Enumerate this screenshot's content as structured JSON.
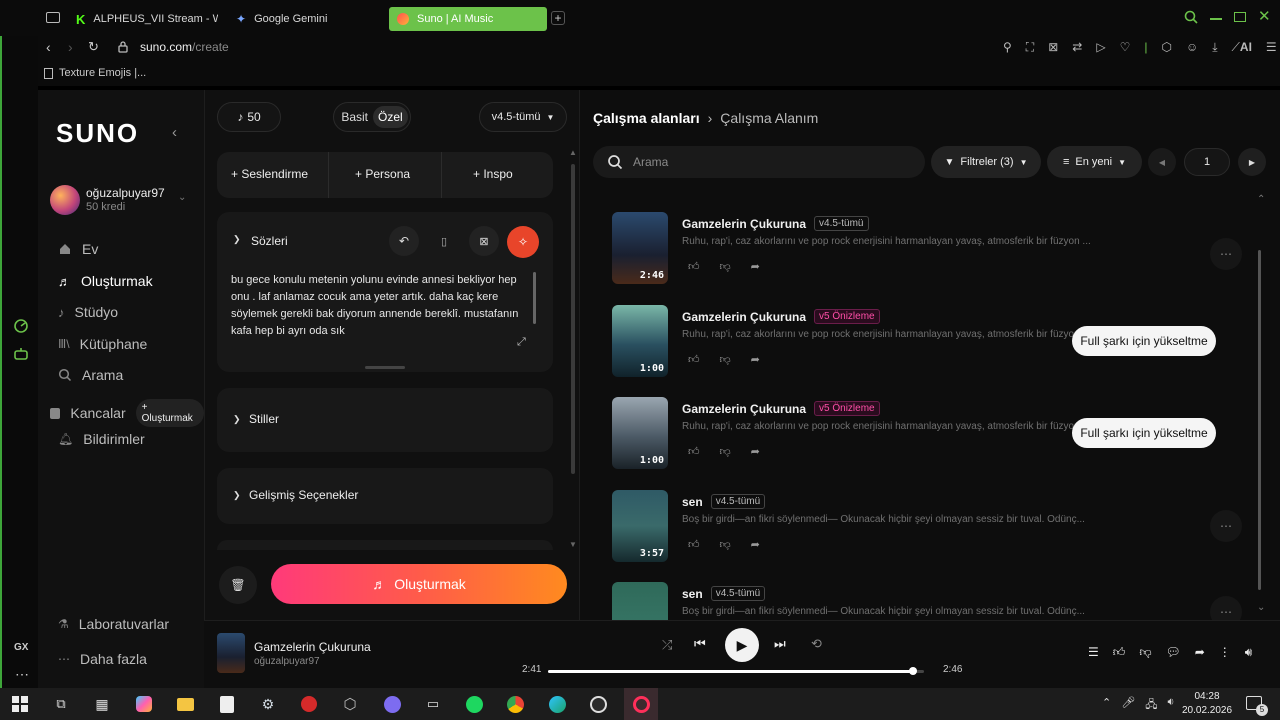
{
  "browser": {
    "tabs": [
      {
        "label": "ALPHEUS_VII Stream - Wa",
        "icon": "kick-logo-icon"
      },
      {
        "label": "Google Gemini",
        "icon": "gemini-icon"
      },
      {
        "label": "Suno | AI Music",
        "icon": "suno-icon",
        "active": true
      }
    ],
    "url_host": "suno.com",
    "url_path": "/create",
    "bookmark": "Texture Emojis |...",
    "ai_label": "AI"
  },
  "sidebar": {
    "logo": "SUNO",
    "user": {
      "name": "oğuzalpuyar97",
      "credits": "50 kredi"
    },
    "items": [
      {
        "label": "Ev",
        "icon": "home-icon"
      },
      {
        "label": "Oluşturmak",
        "icon": "music-note-icon",
        "active": true
      },
      {
        "label": "Stüdyo",
        "icon": "studio-icon"
      },
      {
        "label": "Kütüphane",
        "icon": "library-icon"
      },
      {
        "label": "Arama",
        "icon": "search-icon"
      },
      {
        "label": "Kancalar",
        "icon": "hooks-icon",
        "badge": "+ Oluşturmak"
      },
      {
        "label": "Bildirimler",
        "icon": "bell-icon"
      }
    ],
    "bottom": [
      {
        "label": "Laboratuvarlar",
        "icon": "flask-icon"
      },
      {
        "label": "Daha fazla",
        "icon": "more-icon"
      }
    ]
  },
  "create": {
    "credits": "50",
    "mode_basic": "Basit",
    "mode_custom": "Özel",
    "model": "v4.5-tümü",
    "actions": [
      "+ Seslendirme",
      "+ Persona",
      "+ Inspo"
    ],
    "lyrics_title": "Sözleri",
    "lyrics_text": "bu gece konulu metenin yolunu evinde annesi bekliyor hep onu . laf anlamaz cocuk   ama yeter artık. daha kaç kere söylemek gerekli bak diyorum annende bereklî. mustafanın kafa hep bi  ayrı oda sık",
    "styles_title": "Stiller",
    "advanced_title": "Gelişmiş Seçenekler",
    "create_button": "Oluşturmak"
  },
  "workspace": {
    "breadcrumb_root": "Çalışma alanları",
    "breadcrumb_current": "Çalışma Alanım",
    "search_placeholder": "Arama",
    "filters": "Filtreler (3)",
    "sort": "En yeni",
    "page": "1",
    "songs": [
      {
        "title": "Gamzelerin Çukuruna",
        "tag": "v4.5-tümü",
        "tag_style": "gray",
        "desc": "Ruhu, rap'i, caz akorlarını ve pop rock enerjisini harmanlayan yavaş, atmosferik bir füzyon ...",
        "duration": "2:46",
        "upgrade": ""
      },
      {
        "title": "Gamzelerin Çukuruna",
        "tag": "v5 Önizleme",
        "tag_style": "pink",
        "desc": "Ruhu, rap'i, caz akorlarını ve pop rock enerjisini harmanlayan yavaş, atmosferik bir füzyon olan ...",
        "duration": "1:00",
        "upgrade": "Full şarkı için yükseltme"
      },
      {
        "title": "Gamzelerin Çukuruna",
        "tag": "v5 Önizleme",
        "tag_style": "pink",
        "desc": "Ruhu, rap'i, caz akorlarını ve pop rock enerjisini harmanlayan yavaş, atmosferik bir füzyon olan ...",
        "duration": "1:00",
        "upgrade": "Full şarkı için yükseltme"
      },
      {
        "title": "sen",
        "tag": "v4.5-tümü",
        "tag_style": "gray",
        "desc": "Boş bir girdi—an fikri söylenmedi— Okunacak hiçbir şeyi olmayan sessiz bir tuval. Odünç...",
        "duration": "3:57",
        "upgrade": ""
      },
      {
        "title": "sen",
        "tag": "v4.5-tümü",
        "tag_style": "gray",
        "desc": "Boş bir girdi—an fikri söylenmedi— Okunacak hiçbir şeyi olmayan sessiz bir tuval. Odünç...",
        "duration": "",
        "upgrade": ""
      }
    ]
  },
  "player": {
    "title": "Gamzelerin Çukuruna",
    "artist": "oğuzalpuyar97",
    "elapsed": "2:41",
    "total": "2:46",
    "progress": 0.97
  },
  "gx": {
    "label": "GX"
  },
  "taskbar": {
    "time": "04:28",
    "date": "20.02.2026",
    "notif": "5"
  },
  "colors": {
    "accent_green": "#6cc24a",
    "create_gradient_start": "#ff3a7a",
    "create_gradient_end": "#ff8a1f",
    "pink_tag": "#ff4fa8"
  }
}
